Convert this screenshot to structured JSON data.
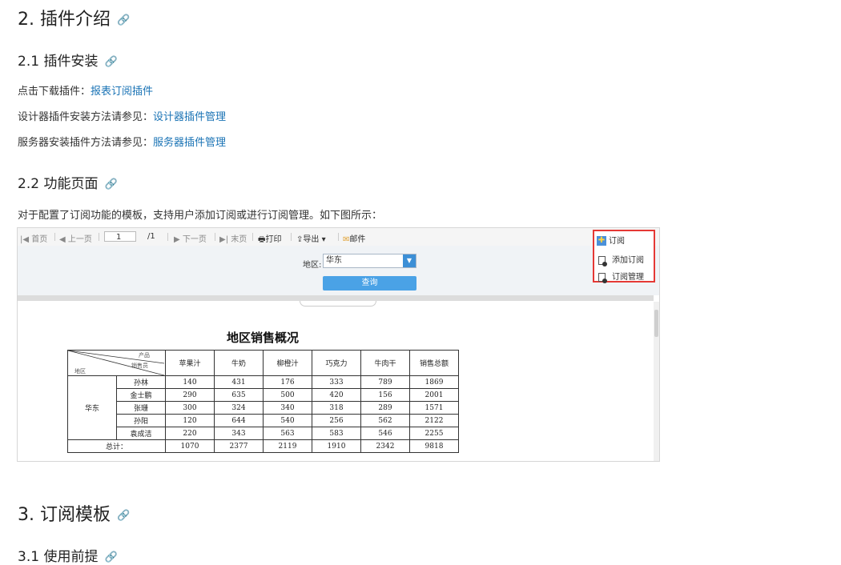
{
  "section2": {
    "title": "2. 插件介绍"
  },
  "section21": {
    "title": "2.1 插件安装",
    "lines": [
      {
        "text": "点击下载插件：",
        "link": "报表订阅插件"
      },
      {
        "text": "设计器插件安装方法请参见：",
        "link": "设计器插件管理"
      },
      {
        "text": "服务器安装插件方法请参见：",
        "link": "服务器插件管理"
      }
    ]
  },
  "section22": {
    "title": "2.2 功能页面",
    "desc": "对于配置了订阅功能的模板，支持用户添加订阅或进行订阅管理。如下图所示："
  },
  "screenshot": {
    "toolbar": {
      "first": "首页",
      "prev": "上一页",
      "page": "1",
      "total": "/1",
      "next": "下一页",
      "last": "末页",
      "print": "打印",
      "export": "导出",
      "mail": "邮件"
    },
    "subscribe": {
      "label": "订阅",
      "add": "添加订阅",
      "manage": "订阅管理"
    },
    "filter": {
      "label": "地区:",
      "value": "华东",
      "query": "查询"
    },
    "report": {
      "title": "地区销售概况",
      "corner": {
        "product": "产品",
        "salesperson": "销售员",
        "region": "地区"
      },
      "columns": [
        "苹果汁",
        "牛奶",
        "柳橙汁",
        "巧克力",
        "牛肉干",
        "销售总额"
      ],
      "region": "华东",
      "rows": [
        {
          "name": "孙林",
          "values": [
            "140",
            "431",
            "176",
            "333",
            "789",
            "1869"
          ]
        },
        {
          "name": "金士鹏",
          "values": [
            "290",
            "635",
            "500",
            "420",
            "156",
            "2001"
          ]
        },
        {
          "name": "张珊",
          "values": [
            "300",
            "324",
            "340",
            "318",
            "289",
            "1571"
          ]
        },
        {
          "name": "孙阳",
          "values": [
            "120",
            "644",
            "540",
            "256",
            "562",
            "2122"
          ]
        },
        {
          "name": "袁成洁",
          "values": [
            "220",
            "343",
            "563",
            "583",
            "546",
            "2255"
          ]
        }
      ],
      "total": {
        "label": "总计：",
        "values": [
          "1070",
          "2377",
          "2119",
          "1910",
          "2342",
          "9818"
        ]
      }
    }
  },
  "section3": {
    "title": "3. 订阅模板"
  },
  "section31": {
    "title": "3.1 使用前提"
  },
  "icons": {
    "anchor": "link-icon"
  }
}
